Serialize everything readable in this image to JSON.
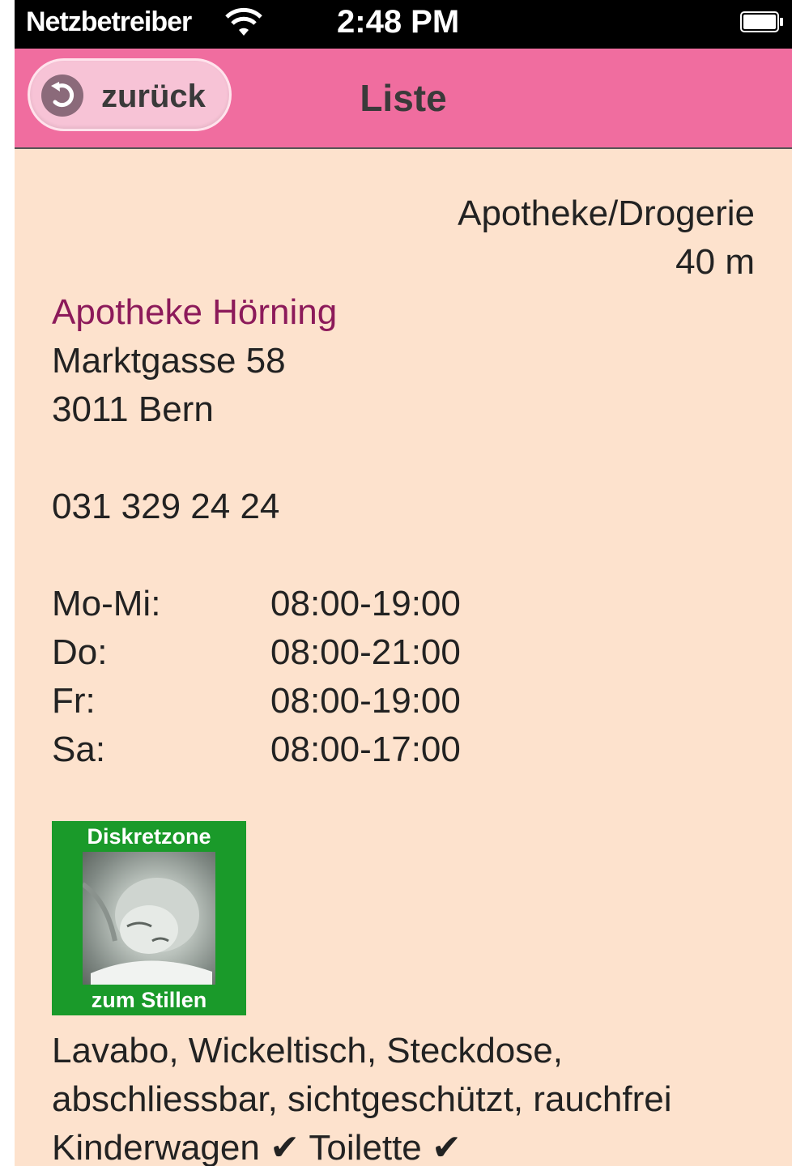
{
  "status_bar": {
    "carrier": "Netzbetreiber",
    "time": "2:48 PM"
  },
  "nav": {
    "back_label": "zurück",
    "title": "Liste"
  },
  "detail": {
    "category": "Apotheke/Drogerie",
    "distance": "40 m",
    "name": "Apotheke Hörning",
    "street": "Marktgasse 58",
    "city": "3011 Bern",
    "phone": "031 329 24 24",
    "hours": [
      {
        "day": "Mo-Mi:",
        "time": "08:00-19:00"
      },
      {
        "day": "Do:",
        "time": "08:00-21:00"
      },
      {
        "day": "Fr:",
        "time": "08:00-19:00"
      },
      {
        "day": "Sa:",
        "time": "08:00-17:00"
      }
    ],
    "badge": {
      "top_text": "Diskretzone",
      "bottom_text": "zum Stillen"
    },
    "amenities_line1": "Lavabo, Wickeltisch, Steckdose,",
    "amenities_line2": "abschliessbar, sichtgeschützt, rauchfrei",
    "amenities_line3": "Kinderwagen ✔ Toilette ✔"
  },
  "colors": {
    "nav_background": "#f06d9f",
    "page_background": "#fde2cd",
    "name_color": "#8c1a5a",
    "badge_green": "#1a9a2a"
  }
}
